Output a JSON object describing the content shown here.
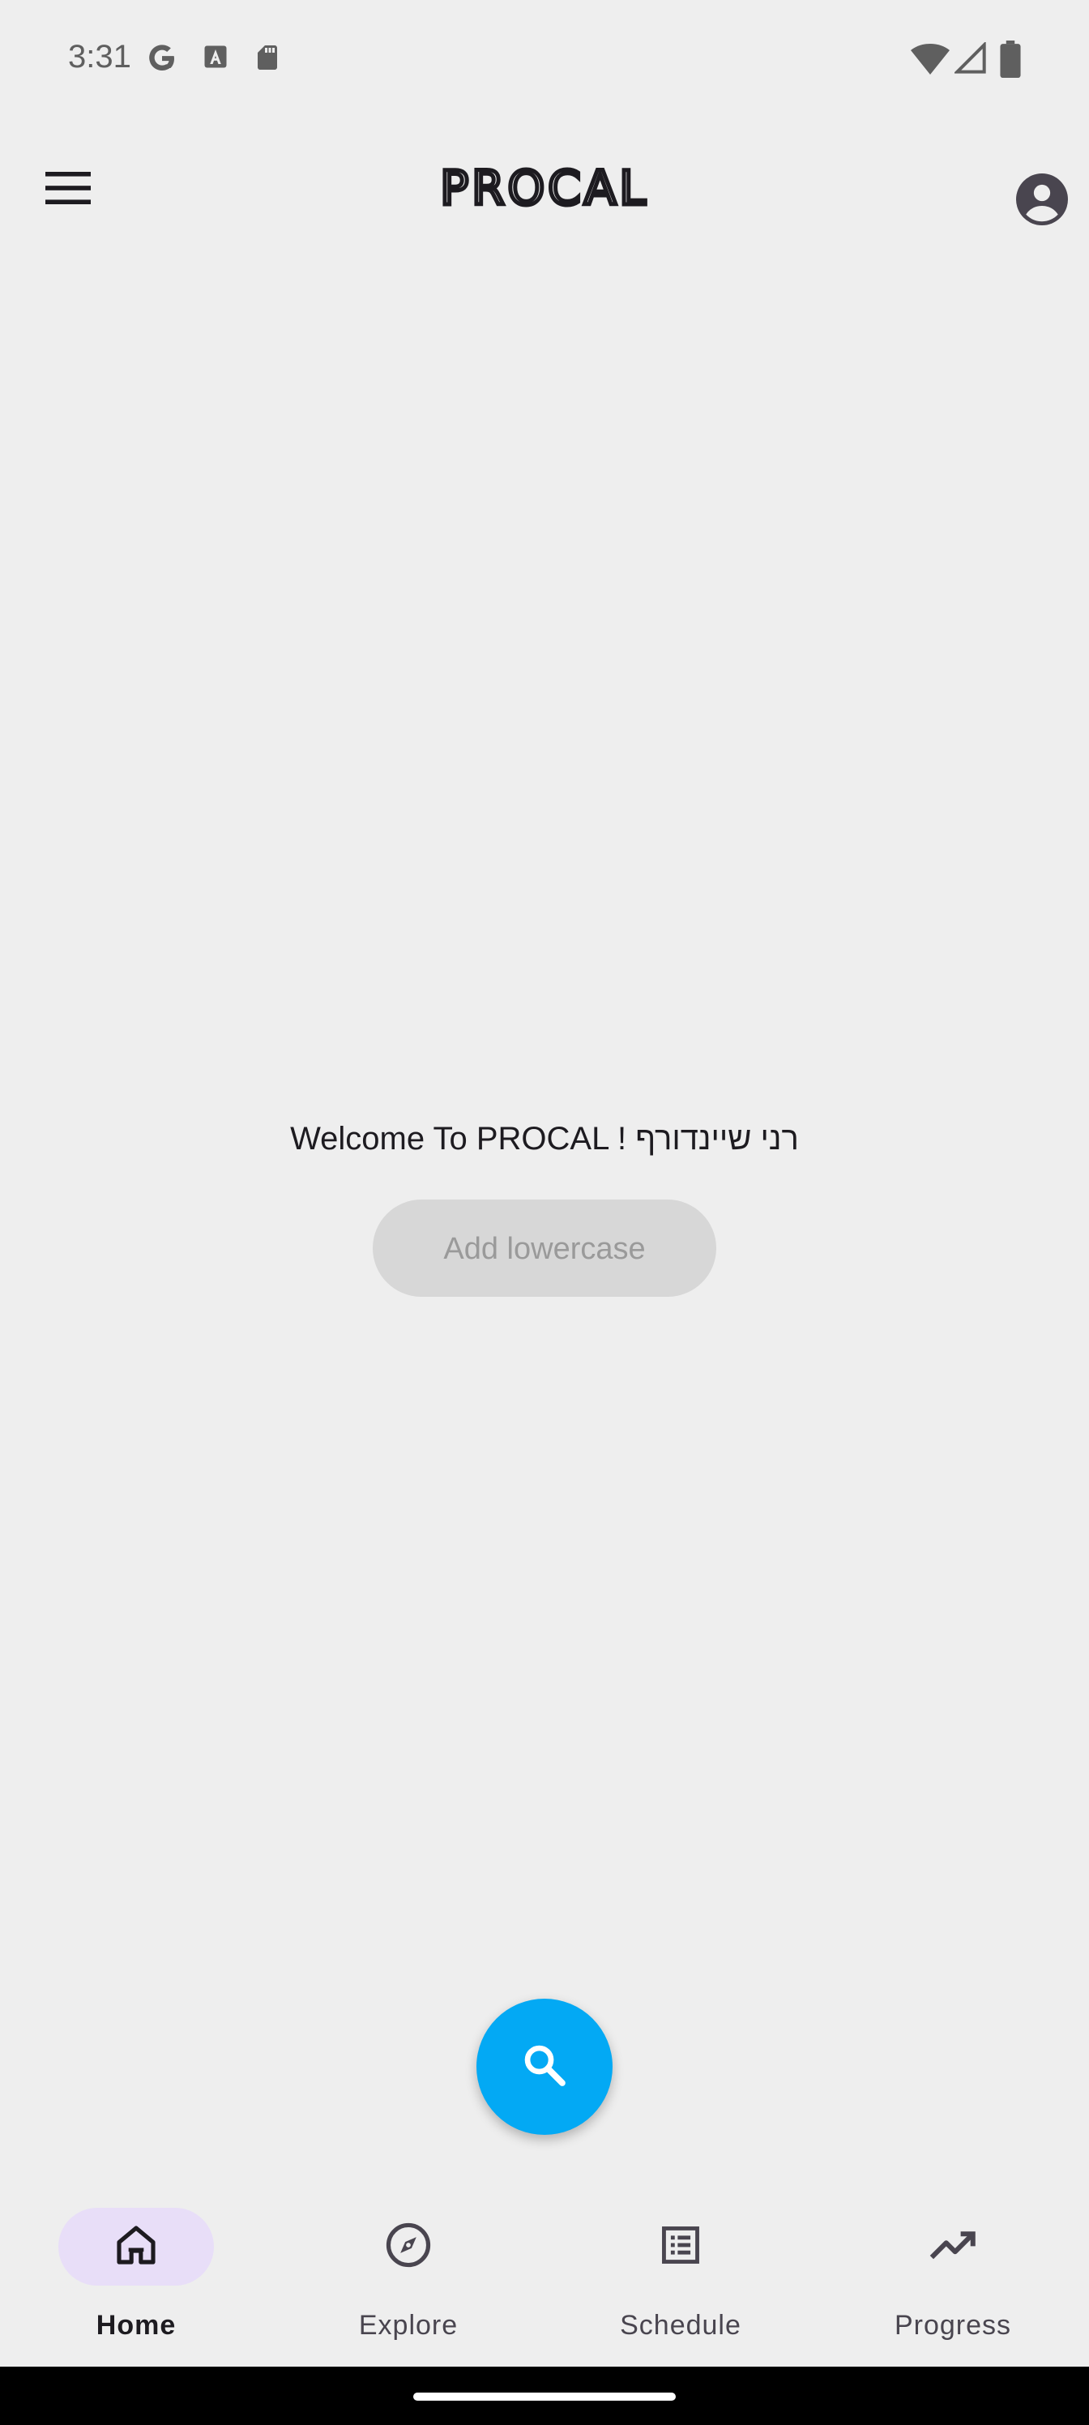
{
  "status_bar": {
    "time": "3:31",
    "left_icons": [
      "google-g-icon",
      "font-a-icon",
      "sd-card-icon"
    ],
    "right_icons": [
      "wifi-icon",
      "cellular-signal-icon",
      "battery-icon"
    ]
  },
  "app_bar": {
    "logo_text": "PROCAL",
    "menu_icon": "hamburger-menu-icon",
    "account_icon": "account-circle-icon"
  },
  "main": {
    "welcome_text": "Welcome To PROCAL ! רני שיינדורף",
    "add_button_label": "Add lowercase"
  },
  "fab": {
    "icon": "search-icon",
    "color": "#03a9f4"
  },
  "bottom_nav": {
    "items": [
      {
        "label": "Home",
        "icon": "home-icon",
        "active": true
      },
      {
        "label": "Explore",
        "icon": "compass-icon",
        "active": false
      },
      {
        "label": "Schedule",
        "icon": "list-alt-icon",
        "active": false
      },
      {
        "label": "Progress",
        "icon": "trending-up-icon",
        "active": false
      }
    ]
  },
  "colors": {
    "background": "#eeeeee",
    "active_indicator": "#e8def8",
    "fab": "#03a9f4",
    "disabled_button": "#d7d7d7"
  }
}
